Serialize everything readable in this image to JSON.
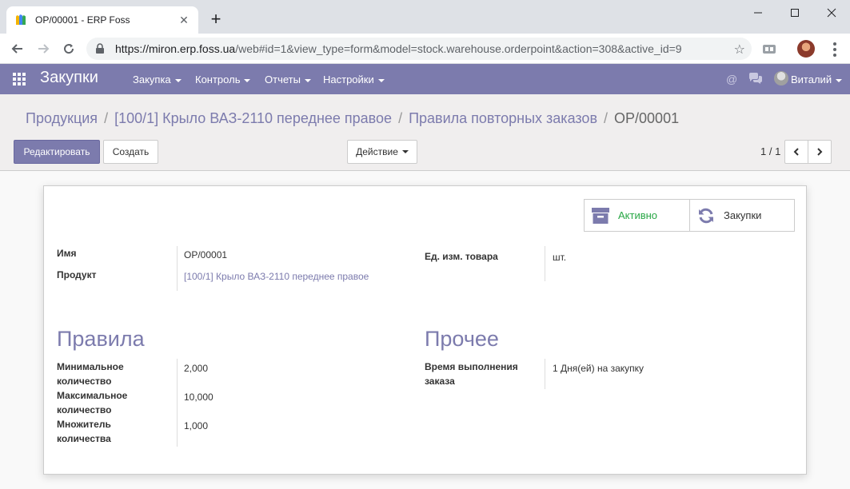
{
  "browser": {
    "tab_title": "OP/00001 - ERP Foss",
    "url_host": "https://miron.erp.foss.ua",
    "url_path": "/web#id=1&view_type=form&model=stock.warehouse.orderpoint&action=308&active_id=9",
    "icons": [
      "back-arrow-icon",
      "forward-arrow-icon",
      "reload-icon",
      "lock-icon",
      "star-icon",
      "extension-icon",
      "profile-avatar",
      "kebab-menu-icon"
    ]
  },
  "navbar": {
    "app_title": "Закупки",
    "menus": [
      {
        "label": "Закупка"
      },
      {
        "label": "Контроль"
      },
      {
        "label": "Отчеты"
      },
      {
        "label": "Настройки"
      }
    ],
    "user_name": "Виталий",
    "accent_color": "#7c7bad"
  },
  "breadcrumb": {
    "items": [
      {
        "label": "Продукция"
      },
      {
        "label": "[100/1] Крыло ВАЗ-2110 переднее правое"
      },
      {
        "label": "Правила повторных заказов"
      }
    ],
    "current": "OP/00001"
  },
  "toolbar": {
    "edit_label": "Редактировать",
    "create_label": "Создать",
    "action_label": "Действие",
    "pager_value": "1 / 1"
  },
  "form": {
    "stat_buttons": {
      "active_label": "Активно",
      "procurements_label": "Закупки"
    },
    "fields": {
      "name_label": "Имя",
      "name_value": "OP/00001",
      "product_label": "Продукт",
      "product_value": "[100/1] Крыло ВАЗ-2110 переднее правое",
      "uom_label": "Ед. изм. товара",
      "uom_value": "шт."
    },
    "rules": {
      "title": "Правила",
      "min_label_1": "Минимальное",
      "min_label_2": "количество",
      "min_value": "2,000",
      "max_label_1": "Максимальное",
      "max_label_2": "количество",
      "max_value": "10,000",
      "mult_label_1": "Множитель",
      "mult_label_2": "количества",
      "mult_value": "1,000"
    },
    "other": {
      "title": "Прочее",
      "lead_label_1": "Время выполнения",
      "lead_label_2": "заказа",
      "lead_value": "1 Дня(ей) на закупку"
    }
  }
}
